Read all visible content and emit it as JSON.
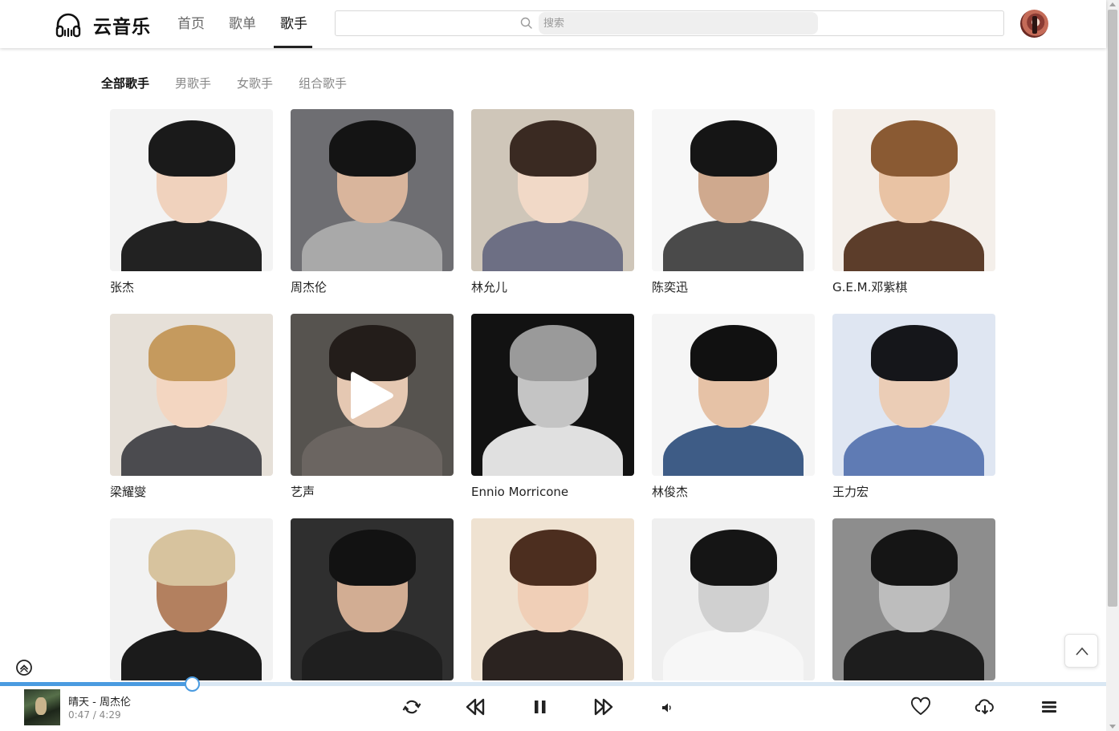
{
  "app": {
    "logo_text": "云音乐"
  },
  "nav": [
    {
      "label": "首页",
      "active": false
    },
    {
      "label": "歌单",
      "active": false
    },
    {
      "label": "歌手",
      "active": true
    }
  ],
  "search": {
    "placeholder": "搜索",
    "value": ""
  },
  "categories": [
    {
      "label": "全部歌手",
      "active": true
    },
    {
      "label": "男歌手",
      "active": false
    },
    {
      "label": "女歌手",
      "active": false
    },
    {
      "label": "组合歌手",
      "active": false
    }
  ],
  "artists": [
    {
      "name": "张杰",
      "bg": "#f3f3f3",
      "hair": "#1a1a1a",
      "skin": "#f0d2bd",
      "body": "#222222"
    },
    {
      "name": "周杰伦",
      "bg": "#6e6e72",
      "hair": "#141414",
      "skin": "#d9b59c",
      "body": "#a9a9a9"
    },
    {
      "name": "林允儿",
      "bg": "#cfc6b9",
      "hair": "#3a2a22",
      "skin": "#f1d9c7",
      "body": "#6d6f84"
    },
    {
      "name": "陈奕迅",
      "bg": "#f7f7f7",
      "hair": "#151515",
      "skin": "#cfa98e",
      "body": "#4a4a4a"
    },
    {
      "name": "G.E.M.邓紫棋",
      "bg": "#f4efea",
      "hair": "#8a5a33",
      "skin": "#e9c3a4",
      "body": "#5c3d2a"
    },
    {
      "name": "梁耀燮",
      "bg": "#e6e0d8",
      "hair": "#c59a5e",
      "skin": "#f3d6c1",
      "body": "#4b4b4f"
    },
    {
      "name": "艺声",
      "bg": "#56534f",
      "hair": "#231d1a",
      "skin": "#e5c8b2",
      "body": "#6b6561",
      "play": true
    },
    {
      "name": "Ennio Morricone",
      "bg": "#121212",
      "hair": "#9a9a9a",
      "skin": "#c4c4c4",
      "body": "#e0e0e0"
    },
    {
      "name": "林俊杰",
      "bg": "#f5f5f5",
      "hair": "#111111",
      "skin": "#e6c2a6",
      "body": "#3e5c86"
    },
    {
      "name": "王力宏",
      "bg": "#dfe6f2",
      "hair": "#15161a",
      "skin": "#ebcdb6",
      "body": "#5f7bb4"
    },
    {
      "name": "",
      "bg": "#f2f2f2",
      "hair": "#d7c39e",
      "skin": "#b3805f",
      "body": "#1b1b1b"
    },
    {
      "name": "",
      "bg": "#2f2f2f",
      "hair": "#121212",
      "skin": "#d2ad93",
      "body": "#1f1f1f"
    },
    {
      "name": "",
      "bg": "#efe2d1",
      "hair": "#4c2e1f",
      "skin": "#f0cfb7",
      "body": "#2b2320"
    },
    {
      "name": "",
      "bg": "#efefef",
      "hair": "#151515",
      "skin": "#d0d0d0",
      "body": "#f7f7f7"
    },
    {
      "name": "",
      "bg": "#8d8d8d",
      "hair": "#151515",
      "skin": "#bdbdbd",
      "body": "#1d1d1d"
    }
  ],
  "player": {
    "song": "晴天 - 周杰伦",
    "current": "0:47",
    "separator": "/",
    "duration": "4:29",
    "progress": 0.174,
    "accent": "#4a9be0",
    "controls": [
      "loop-icon",
      "previous-icon",
      "pause-icon",
      "next-icon",
      "volume-icon"
    ],
    "actions": [
      "heart-icon",
      "download-icon",
      "playlist-icon"
    ]
  }
}
